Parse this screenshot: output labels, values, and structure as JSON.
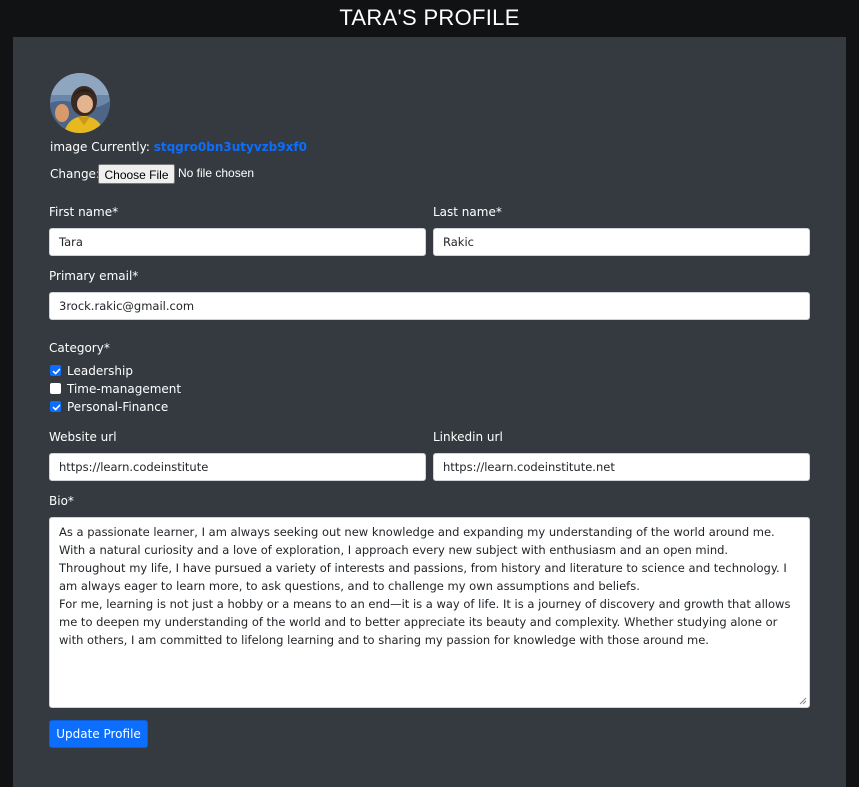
{
  "header": {
    "title": "TARA'S PROFILE"
  },
  "image": {
    "currently_label": "image Currently:",
    "current_value": "stqgro0bn3utyvzb9xf0",
    "change_label": "Change:",
    "choose_button": "Choose File",
    "file_status": "No file chosen",
    "avatar_icon": "profile-photo"
  },
  "form": {
    "first_name": {
      "label": "First name*",
      "value": "Tara"
    },
    "last_name": {
      "label": "Last name*",
      "value": "Rakic"
    },
    "email": {
      "label": "Primary email*",
      "value": "3rock.rakic@gmail.com"
    },
    "category": {
      "label": "Category*",
      "options": [
        {
          "label": "Leadership",
          "checked": true
        },
        {
          "label": "Time-management",
          "checked": false
        },
        {
          "label": "Personal-Finance",
          "checked": true
        }
      ]
    },
    "website": {
      "label": "Website url",
      "value": "https://learn.codeinstitute"
    },
    "linkedin": {
      "label": "Linkedin url",
      "value": "https://learn.codeinstitute.net"
    },
    "bio": {
      "label": "Bio*",
      "paragraphs": [
        "As a passionate learner, I am always seeking out new knowledge and expanding my understanding of the world around me. With a natural curiosity and a love of exploration, I approach every new subject with enthusiasm and an open mind.",
        "Throughout my life, I have pursued a variety of interests and passions, from history and literature to science and technology. I am always eager to learn more, to ask questions, and to challenge my own assumptions and beliefs.",
        "For me, learning is not just a hobby or a means to an end—it is a way of life. It is a journey of discovery and growth that allows me to deepen my understanding of the world and to better appreciate its beauty and complexity. Whether studying alone or with others, I am committed to lifelong learning and to sharing my passion for knowledge with those around me."
      ]
    },
    "submit_label": "Update Profile"
  },
  "colors": {
    "page_bg": "#111214",
    "panel_bg": "#343a40",
    "accent": "#0d6efd"
  }
}
